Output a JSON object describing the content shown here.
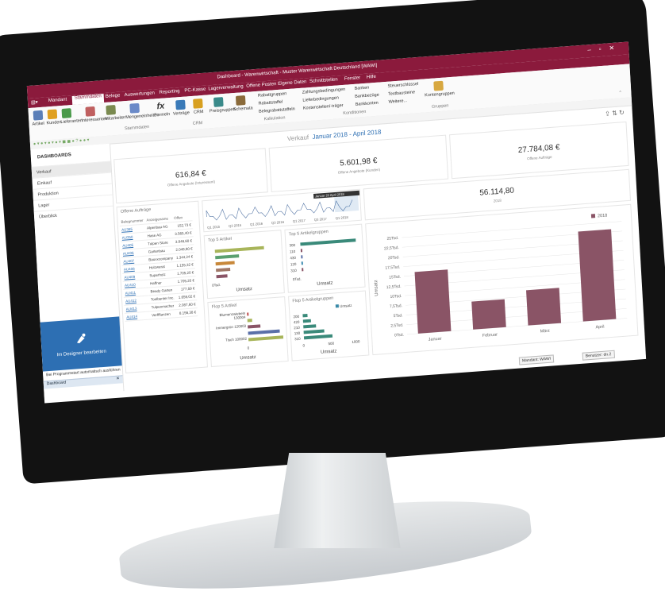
{
  "window": {
    "title": "Dashboard - Warenwirtschaft - Muster Warenwirtschaft Deutschland [WAWI]",
    "controls": [
      "–",
      "▫",
      "✕"
    ]
  },
  "menu": {
    "items": [
      "Mandant",
      "Stammdaten",
      "Belege",
      "Auswertungen",
      "Reporting",
      "PC-Kasse",
      "Lagerverwaltung",
      "Offene Posten",
      "Eigene Daten",
      "Schnittstellen",
      "Fenster",
      "Hilfe"
    ],
    "active": "Stammdaten"
  },
  "ribbon": {
    "buttons": [
      "Artikel",
      "Kunden",
      "Lieferanten",
      "Interessenten",
      "Mitarbeiter",
      "Mengeneinheiten",
      "Formeln",
      "Verträge",
      "CRM",
      "Preisgruppen",
      "Schemata"
    ],
    "group_stammdaten": "Stammdaten",
    "group_crm": "CRM",
    "kalkulation": [
      "Rabattgruppen",
      "Rabattstaffel",
      "Belegrabattstaffeln"
    ],
    "group_kalkulation": "Kalkulation",
    "konditionen": [
      "Zahlungsbedingungen",
      "Lieferbedingungen",
      "Kostenstellen/-träger"
    ],
    "banks": [
      "Banken",
      "Bankbezüge",
      "Bankkonten"
    ],
    "misc": [
      "Steuerschlüssel",
      "Textbausteine",
      "Weitere..."
    ],
    "group_konditionen": "Konditionen",
    "kontengruppen": "Kontengruppen",
    "group_gruppen": "Gruppen"
  },
  "sidebar": {
    "header": "DASHBOARDS",
    "items": [
      "Verkauf",
      "Einkauf",
      "Produktion",
      "Lager",
      "Überblick"
    ],
    "selected": "Verkauf",
    "designer_label": "Im Designer bearbeiten",
    "autostart_label": "Bei Programmstart automatisch ausführen",
    "doc_tab": "Dashboard"
  },
  "dashboard": {
    "title": "Verkauf",
    "range": "Januar 2018 - April 2018",
    "kpis": [
      {
        "value": "616,84 €",
        "label": "Offene Angebote (Interessent)"
      },
      {
        "value": "5.601,98 €",
        "label": "Offene Angebote (Kunden)"
      },
      {
        "value": "27.784,08 €",
        "label": "Offene Aufträge"
      }
    ],
    "total": {
      "value": "56.114,80",
      "label": "2018"
    },
    "orders": {
      "title": "Offene Aufträge",
      "columns": [
        "Belegnummer",
        "Anzeigename",
        "Offen"
      ],
      "rows": [
        [
          "AU365",
          "Alpenbau AG",
          "152,73 €"
        ],
        [
          "AU350",
          "Hase AG",
          "3.565,40 €"
        ],
        [
          "AU405",
          "Tulpen Store",
          "3.846,60 €"
        ],
        [
          "AU406",
          "Gartenbau",
          "2.048,80 €"
        ],
        [
          "AU407",
          "Bauxxcompany",
          "1.344,24 €"
        ],
        [
          "AU408",
          "Holzwerat",
          "1.155,32 €"
        ],
        [
          "AU409",
          "Superholz",
          "1.705,20 €"
        ],
        [
          "AU410",
          "Haffner",
          "1.705,20 €"
        ],
        [
          "AU411",
          "Beady Garten",
          "177,59 €"
        ],
        [
          "AU412",
          "Toolbenter Inc.",
          "1.659,02 €"
        ],
        [
          "AU413",
          "Tulpenmacher",
          "2.087,60 €"
        ],
        [
          "AU414",
          "Verffflanzen",
          "8.156,38 €"
        ]
      ]
    },
    "timeline": {
      "tooltip": "Januar 20 April 2018",
      "ticks": [
        "Q1 2015",
        "Q3 2015",
        "Q1 2016",
        "Q3 2016",
        "Q1 2017",
        "Q3 2017",
        "Q1 2018"
      ]
    },
    "top5_artikel": {
      "title": "Top 5 Artikel",
      "xlabel": "Umsatz",
      "zero": "0Tsd."
    },
    "top5_gruppen": {
      "title": "Top 5 Artikelgruppen",
      "xlabel": "Umsatz",
      "zero": "0Tsd.",
      "categories": [
        "300",
        "110",
        "430",
        "120",
        "310"
      ]
    },
    "flop5_artikel": {
      "title": "Flop 5 Artikel",
      "xlabel": "Umsatz",
      "labels": [
        "Blumenzwiebeln 130004",
        "Immergrün 120003",
        "Tisch 100002"
      ],
      "zero": "0"
    },
    "flop5_gruppen": {
      "title": "Flop 5 Artikelgruppen",
      "xlabel": "Umsatz",
      "legend": "Umsatz",
      "categories": [
        "200",
        "420",
        "210",
        "130",
        "310"
      ],
      "ticks": [
        "0",
        "500",
        "1000"
      ]
    }
  },
  "status": {
    "mandant": "Mandant: WAWI",
    "benutzer": "Benutzer: dn.2"
  },
  "colors": {
    "brand": "#8b1a3c",
    "accent": "#2d6fb3",
    "bar": "#8a5466"
  },
  "chart_data": [
    {
      "type": "bar",
      "categories": [
        "Januar",
        "Februar",
        "März",
        "April"
      ],
      "series": [
        {
          "name": "2018",
          "values": [
            15900,
            7200,
            9100,
            23200
          ]
        }
      ],
      "ylabel": "Umsatz",
      "yticks": [
        "0Tsd.",
        "2,5Tsd.",
        "5Tsd.",
        "7,5Tsd.",
        "10Tsd.",
        "12,5Tsd.",
        "15Tsd.",
        "17,5Tsd.",
        "20Tsd.",
        "22,5Tsd.",
        "25Tsd."
      ],
      "ylim": [
        0,
        25000
      ],
      "legend": "top-right"
    }
  ]
}
